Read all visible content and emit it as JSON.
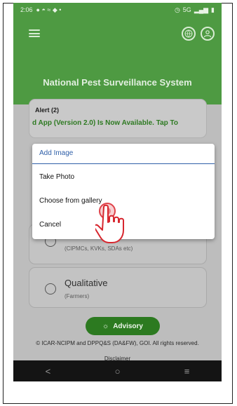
{
  "status_bar": {
    "time": "2:06",
    "right_text": "5G"
  },
  "header": {
    "app_title": "National Pest Surveillance System"
  },
  "alert": {
    "title": "Alert (2)",
    "marquee": "d App (Version 2.0) Is Now Available. Tap To"
  },
  "dialog": {
    "title": "Add Image",
    "options": [
      "Take Photo",
      "Choose from gallery",
      "Cancel"
    ]
  },
  "stakeholders": {
    "subtitle": "(CIPMCs, KVKs, SDAs etc)"
  },
  "qualitative": {
    "title": "Qualitative",
    "subtitle": "(Farmers)"
  },
  "advisory": {
    "label": "Advisory"
  },
  "footer": {
    "copyright": "© ICAR-NCIPM and DPPQ&S (DA&FW), GOI. All rights reserved.",
    "disclaimer": "Disclaimer"
  },
  "nav": {
    "back": "<",
    "home": "○",
    "recents": "≡"
  },
  "colors": {
    "header_green": "#4e9a42",
    "accent_blue": "#2f5fa8",
    "advisory_green": "#2c7a20"
  }
}
